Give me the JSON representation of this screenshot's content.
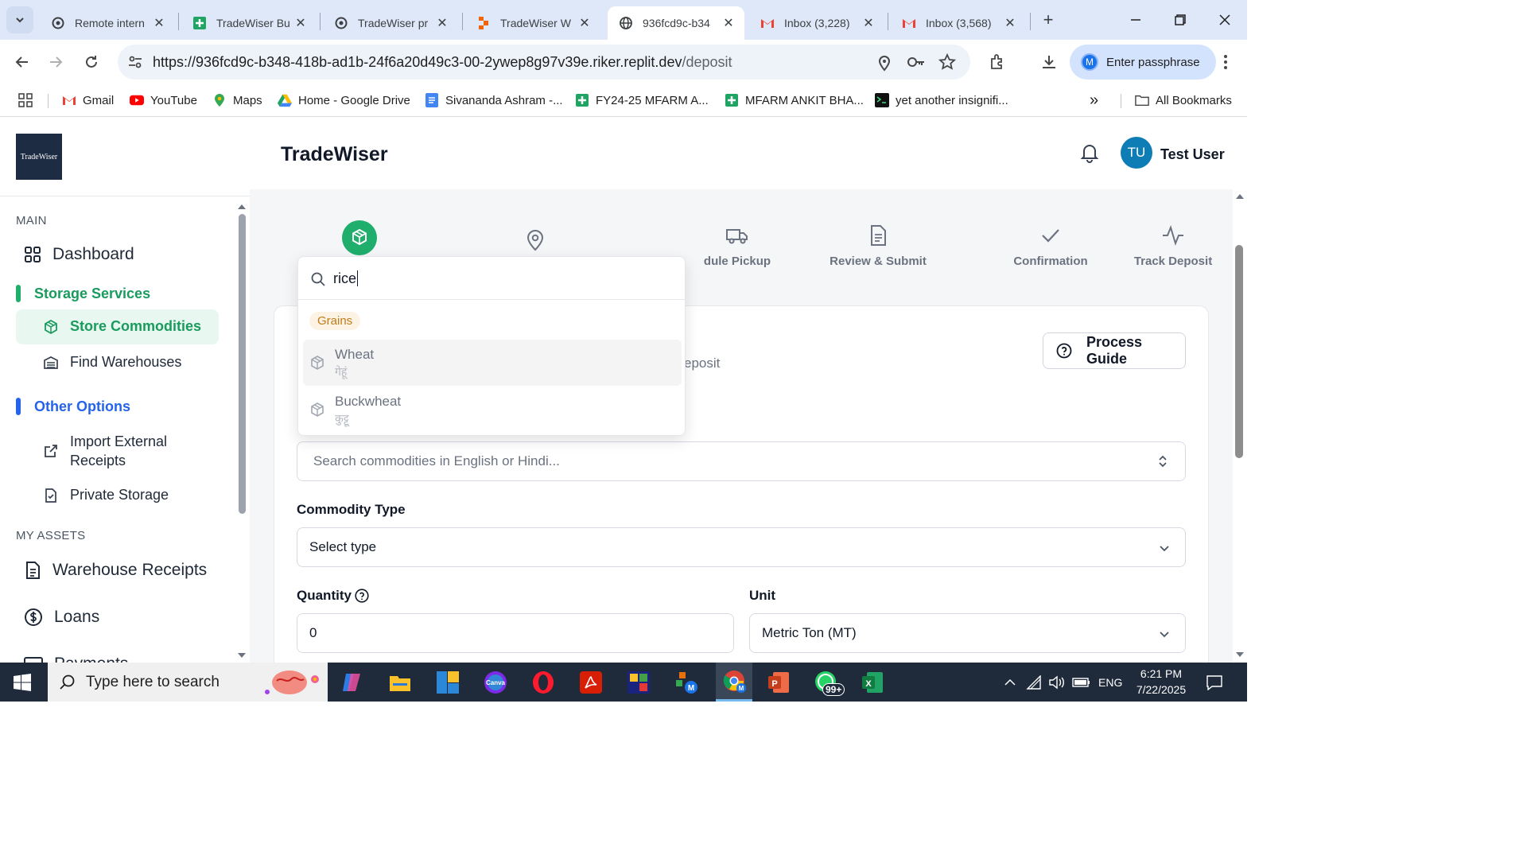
{
  "browser": {
    "tabs": [
      {
        "title": "Remote intern",
        "favicon": "openai-icon"
      },
      {
        "title": "TradeWiser Bu",
        "favicon": "sheets-icon"
      },
      {
        "title": "TradeWiser pr",
        "favicon": "openai-icon"
      },
      {
        "title": "TradeWiser W",
        "favicon": "replit-icon"
      },
      {
        "title": "936fcd9c-b34",
        "favicon": "globe-icon",
        "active": true
      },
      {
        "title": "Inbox (3,228)",
        "favicon": "gmail-icon"
      },
      {
        "title": "Inbox (3,568)",
        "favicon": "gmail-icon"
      }
    ],
    "url_main": "https://936fcd9c-b348-418b-ad1b-24f6a20d49c3-00-2ywep8g97v39e.riker.replit.dev",
    "url_path": "/deposit",
    "passphrase_avatar": "M",
    "passphrase_label": "Enter passphrase",
    "bookmarks": [
      {
        "label": "Gmail"
      },
      {
        "label": "YouTube"
      },
      {
        "label": "Maps"
      },
      {
        "label": "Home - Google Drive"
      },
      {
        "label": "Sivananda Ashram -..."
      },
      {
        "label": "FY24-25 MFARM A..."
      },
      {
        "label": "MFARM ANKIT BHA..."
      },
      {
        "label": "yet another insignifi..."
      }
    ],
    "more_bookmarks": "»",
    "all_bookmarks": "All Bookmarks"
  },
  "app": {
    "logo_text": "TradeWiser",
    "title": "TradeWiser",
    "user_initials": "TU",
    "user_name": "Test User",
    "sidebar": {
      "main_label": "MAIN",
      "dashboard": "Dashboard",
      "storage_group": "Storage Services",
      "store_commodities": "Store Commodities",
      "find_warehouses": "Find Warehouses",
      "other_group": "Other Options",
      "import_receipts": "Import External Receipts",
      "private_storage": "Private Storage",
      "assets_label": "MY ASSETS",
      "warehouse_receipts": "Warehouse Receipts",
      "loans": "Loans",
      "payments_partial": "Payments"
    },
    "steps": [
      {
        "label": "dule Pickup"
      },
      {
        "label": "Review & Submit"
      },
      {
        "label": "Confirmation"
      },
      {
        "label": "Track Deposit"
      }
    ],
    "process_guide": "Process Guide",
    "card_subtitle_partial": "eposit",
    "commodity_search_placeholder": "Search commodities in English or Hindi...",
    "commodity_type_label": "Commodity Type",
    "commodity_type_value": "Select type",
    "quantity_label": "Quantity",
    "quantity_value": "0",
    "unit_label": "Unit",
    "unit_value": "Metric Ton (MT)",
    "dropdown": {
      "query": "rice",
      "group": "Grains",
      "options": [
        {
          "en": "Wheat",
          "hi": "गेहूं"
        },
        {
          "en": "Buckwheat",
          "hi": "कुट्टू"
        }
      ]
    }
  },
  "taskbar": {
    "search_placeholder": "Type here to search",
    "whatsapp_badge": "99+",
    "language": "ENG",
    "time": "6:21 PM",
    "date": "7/22/2025"
  },
  "colors": {
    "brand_green": "#1fae6c",
    "accent_blue": "#2563eb",
    "navy_logo": "#1d2b43"
  }
}
